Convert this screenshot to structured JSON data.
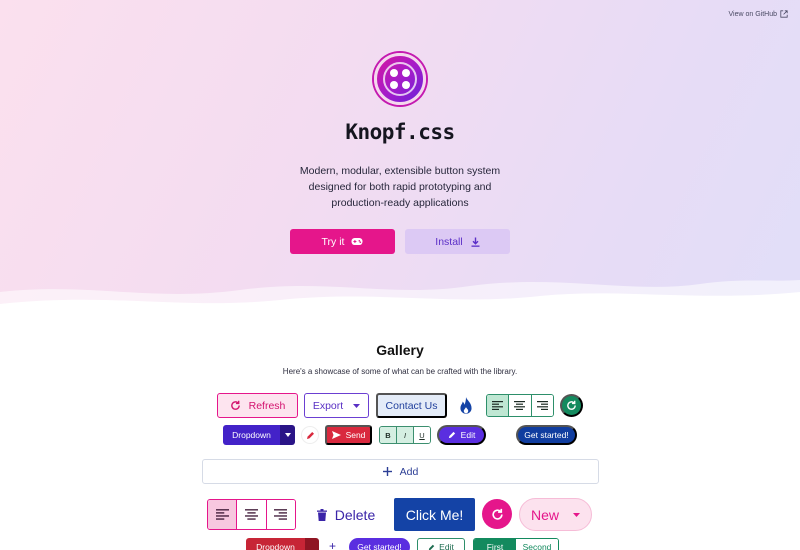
{
  "header": {
    "github_link": "View on GitHub",
    "title": "Knopf.css",
    "tagline": "Modern, modular, extensible button system designed for both rapid prototyping and production-ready applications",
    "try_label": "Try it",
    "install_label": "Install"
  },
  "gallery": {
    "title": "Gallery",
    "subtitle": "Here's a showcase of some of what can be crafted with the library.",
    "row1": {
      "refresh": "Refresh",
      "export": "Export",
      "contact": "Contact Us"
    },
    "row2": {
      "dropdown": "Dropdown",
      "send": "Send",
      "bold": "B",
      "italic": "I",
      "underline": "U",
      "edit": "Edit",
      "get_started": "Get started!"
    },
    "add": "Add",
    "row4": {
      "delete": "Delete",
      "click_me": "Click Me!",
      "new": "New"
    },
    "row5": {
      "dropdown": "Dropdown",
      "get_started": "Get started!",
      "edit": "Edit",
      "first": "First",
      "second": "Second"
    }
  },
  "colors": {
    "pink": "#e5168b",
    "purple": "#5a2ee0",
    "navy": "#1443a6",
    "green": "#138a5e",
    "red": "#d9293e"
  }
}
